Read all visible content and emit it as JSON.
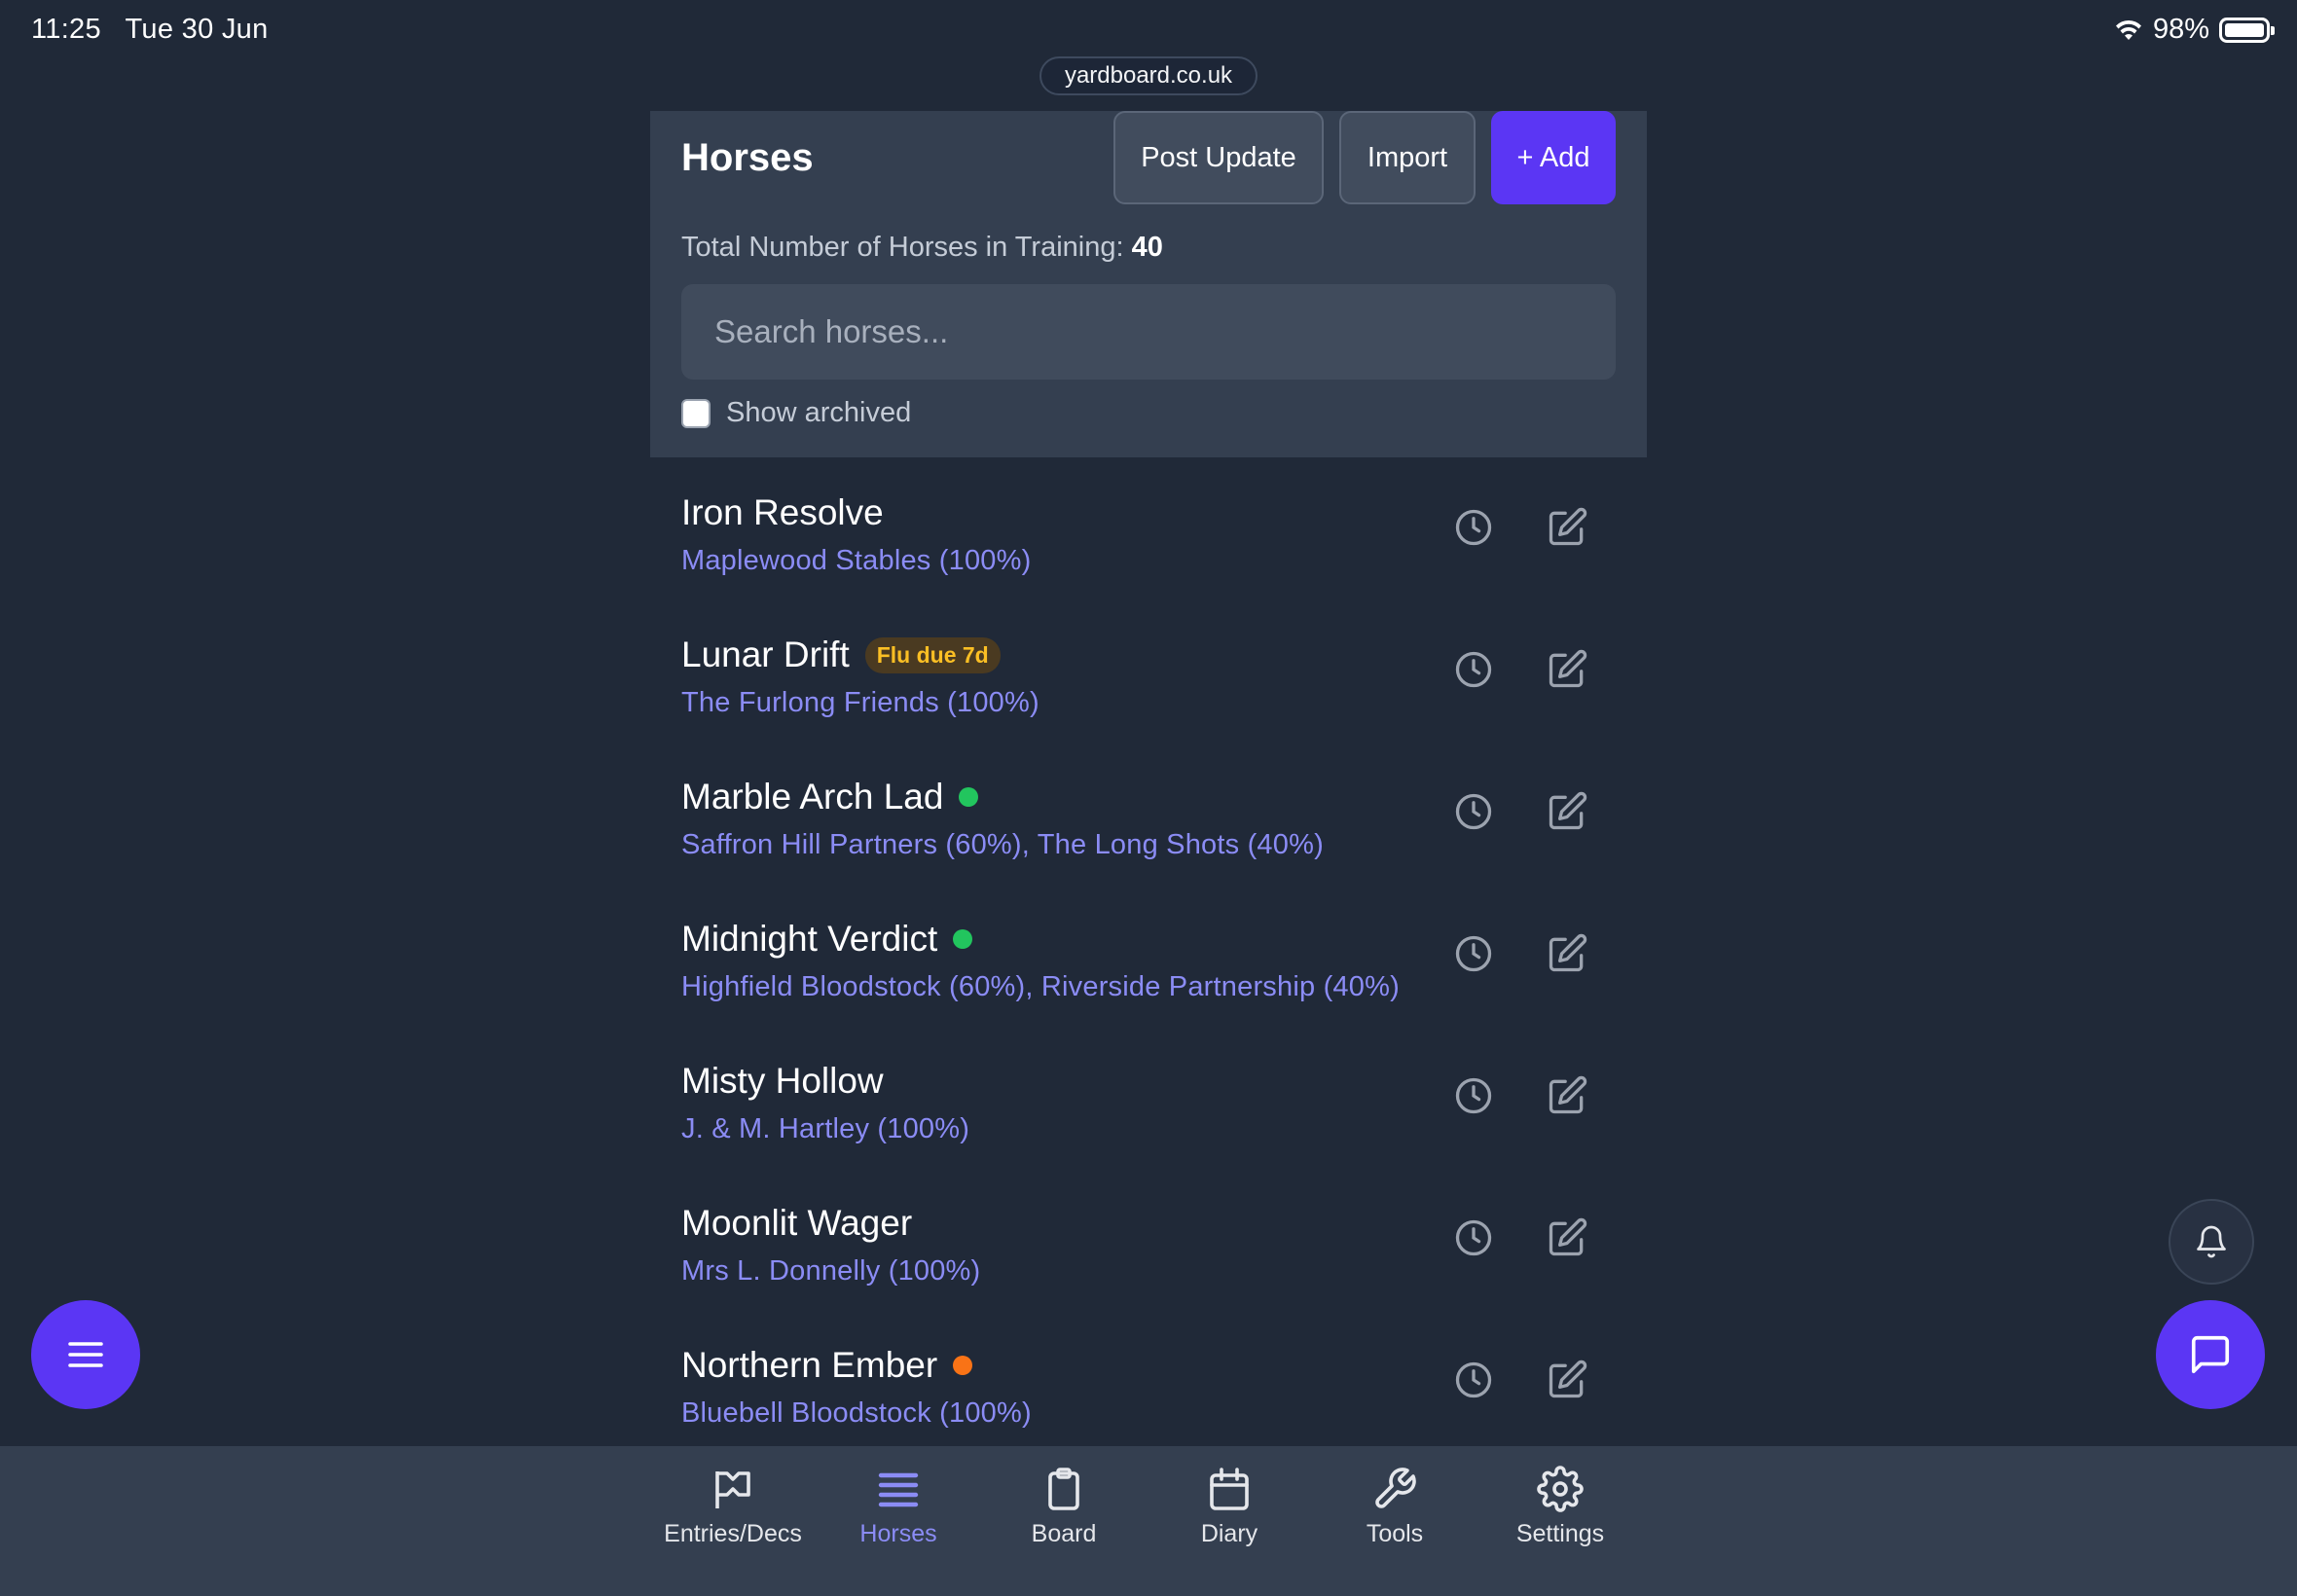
{
  "status_bar": {
    "time": "11:25",
    "date": "Tue 30 Jun",
    "battery": "98%"
  },
  "browser": {
    "url": "yardboard.co.uk"
  },
  "header": {
    "title": "Horses",
    "post_update_label": "Post Update",
    "import_label": "Import",
    "add_label": "+ Add",
    "total_label": "Total Number of Horses in Training:",
    "total_count": "40",
    "search_placeholder": "Search horses...",
    "show_archived_label": "Show archived"
  },
  "horses": [
    {
      "name": "Iron Resolve",
      "owners": "Maplewood Stables (100%)",
      "badge": null,
      "status_dot": null
    },
    {
      "name": "Lunar Drift",
      "owners": "The Furlong Friends (100%)",
      "badge": "Flu due 7d",
      "status_dot": null
    },
    {
      "name": "Marble Arch Lad",
      "owners": "Saffron Hill Partners (60%), The Long Shots (40%)",
      "badge": null,
      "status_dot": "green"
    },
    {
      "name": "Midnight Verdict",
      "owners": "Highfield Bloodstock (60%), Riverside Partnership (40%)",
      "badge": null,
      "status_dot": "green"
    },
    {
      "name": "Misty Hollow",
      "owners": "J. & M. Hartley (100%)",
      "badge": null,
      "status_dot": null
    },
    {
      "name": "Moonlit Wager",
      "owners": "Mrs L. Donnelly (100%)",
      "badge": null,
      "status_dot": null
    },
    {
      "name": "Northern Ember",
      "owners": "Bluebell Bloodstock (100%)",
      "badge": null,
      "status_dot": "orange"
    }
  ],
  "nav": {
    "items": [
      {
        "label": "Entries/Decs",
        "icon": "flag-icon",
        "active": false
      },
      {
        "label": "Horses",
        "icon": "list-icon",
        "active": true
      },
      {
        "label": "Board",
        "icon": "clipboard-icon",
        "active": false
      },
      {
        "label": "Diary",
        "icon": "calendar-icon",
        "active": false
      },
      {
        "label": "Tools",
        "icon": "wrench-icon",
        "active": false
      },
      {
        "label": "Settings",
        "icon": "gear-icon",
        "active": false
      }
    ]
  },
  "colors": {
    "background": "#202938",
    "panel": "#343f50",
    "accent": "#5b36f4",
    "owner_text": "#8b8cf5",
    "status_green": "#22c55e",
    "status_orange": "#f97316",
    "badge_text": "#fbbf24"
  }
}
